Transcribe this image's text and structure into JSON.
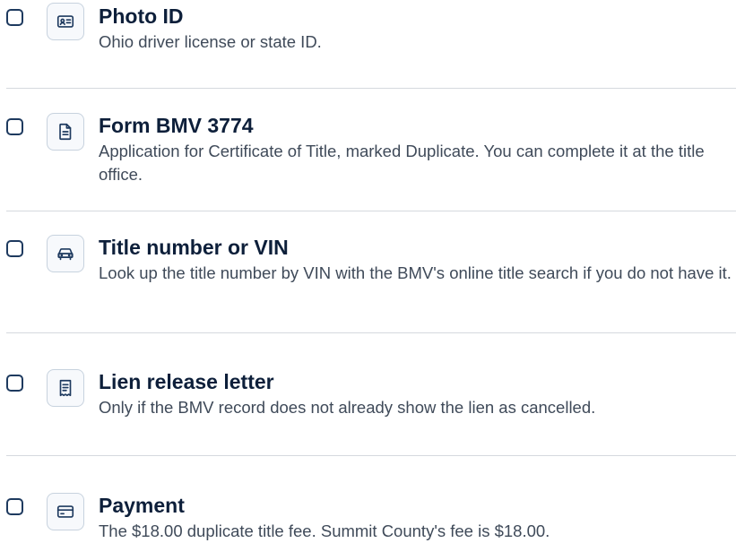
{
  "items": [
    {
      "title": "Photo ID",
      "description": "Ohio driver license or state ID.",
      "icon": "id-card-icon"
    },
    {
      "title": "Form BMV 3774",
      "description": "Application for Certificate of Title, marked Duplicate. You can complete it at the title office.",
      "icon": "document-icon"
    },
    {
      "title": "Title number or VIN",
      "description": "Look up the title number by VIN with the BMV's online title search if you do not have it.",
      "icon": "car-icon"
    },
    {
      "title": "Lien release letter",
      "description": "Only if the BMV record does not already show the lien as cancelled.",
      "icon": "receipt-icon"
    },
    {
      "title": "Payment",
      "description": "The $18.00 duplicate title fee. Summit County's fee is $18.00.",
      "icon": "credit-card-icon"
    }
  ],
  "colors": {
    "accent": "#1e3a5f",
    "title_text": "#0d1f3a",
    "body_text": "#3f4a59",
    "divider": "#d5d9de",
    "icon_border": "#c7d2de"
  }
}
